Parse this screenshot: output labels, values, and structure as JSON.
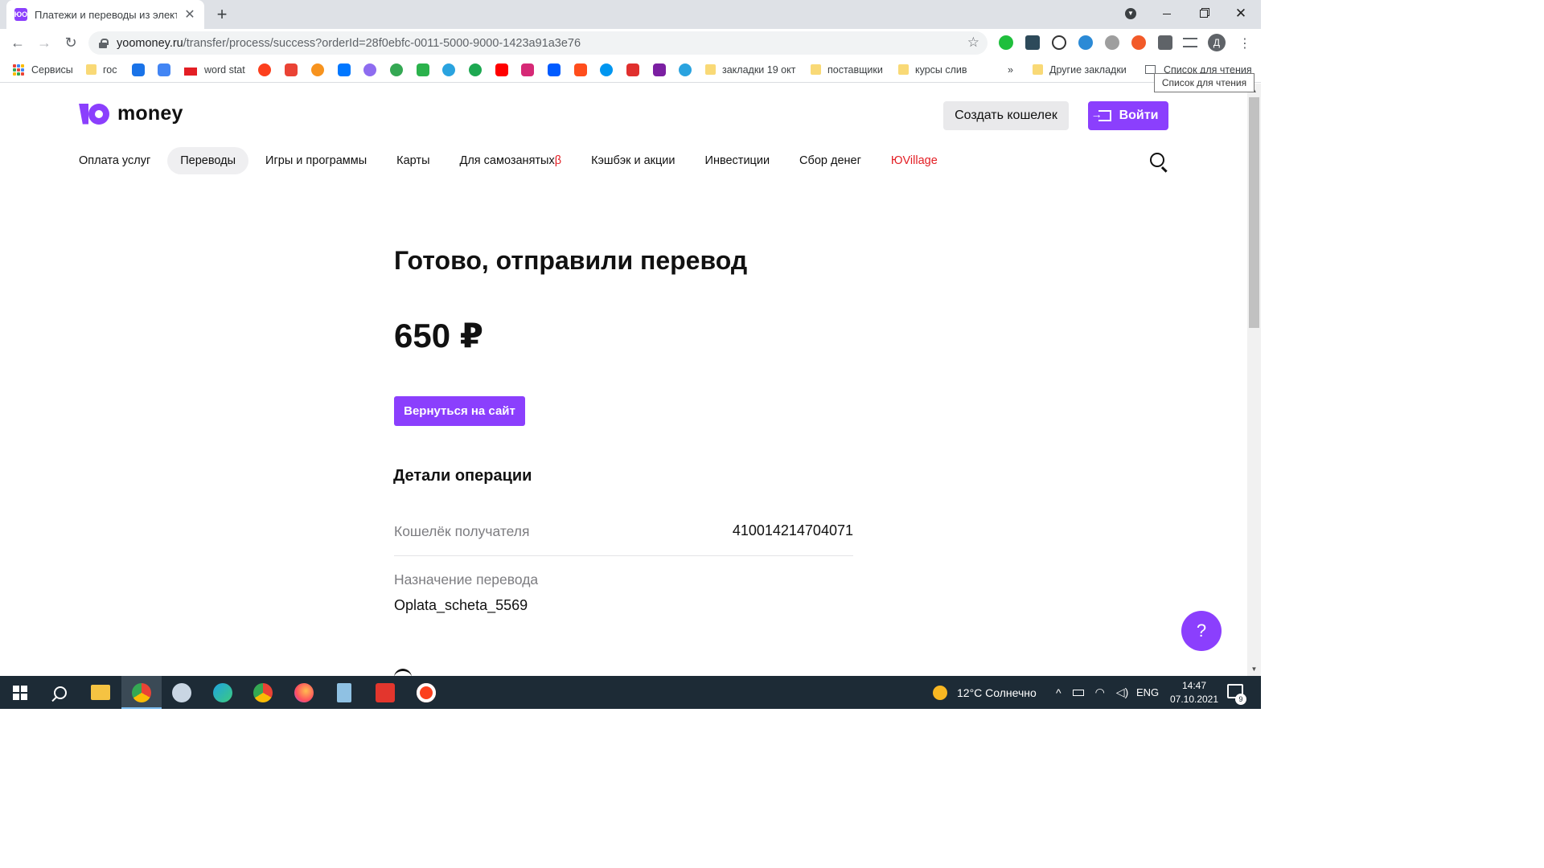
{
  "browser": {
    "tab_title": "Платежи и переводы из электронного кошелька",
    "tab_favicon": "ЮО",
    "url_host": "yoomoney.ru",
    "url_path": "/transfer/process/success?orderId=28f0ebfc-0011-5000-9000-1423a91a3e76",
    "profile_initial": "Д",
    "bookmarks": {
      "apps": "Сервисы",
      "gos": "гос",
      "wordstat": "word stat",
      "z19": "закладки 19 окт",
      "suppliers": "поставщики",
      "courses": "курсы слив",
      "more": "»",
      "other": "Другие закладки",
      "reading_list": "Список для чтения"
    },
    "tooltip": "Список для чтения"
  },
  "site": {
    "logo_text": "money",
    "create_wallet": "Создать кошелек",
    "login": "Войти",
    "nav": [
      {
        "label": "Оплата услуг"
      },
      {
        "label": "Переводы"
      },
      {
        "label": "Игры и программы"
      },
      {
        "label": "Карты"
      },
      {
        "label": "Для самозанятых",
        "badge": "β"
      },
      {
        "label": "Кэшбэк и акции"
      },
      {
        "label": "Инвестиции"
      },
      {
        "label": "Сбор денег"
      },
      {
        "label": "ЮVillage"
      }
    ]
  },
  "main": {
    "title": "Готово, отправили перевод",
    "amount": "650 ₽",
    "back_button": "Вернуться на сайт",
    "details_heading": "Детали операции",
    "recipient_label": "Кошелёк получателя",
    "recipient_value": "410014214704071",
    "purpose_label": "Назначение перевода",
    "purpose_value": "Oplata_scheta_5569",
    "help": "?"
  },
  "taskbar": {
    "weather": "12°C  Солнечно",
    "lang": "ENG",
    "time": "14:47",
    "date": "07.10.2021",
    "notifications": "9"
  },
  "colors": {
    "accent": "#8b3ffd",
    "red": "#e31e24",
    "taskbar": "#1d2b36"
  }
}
